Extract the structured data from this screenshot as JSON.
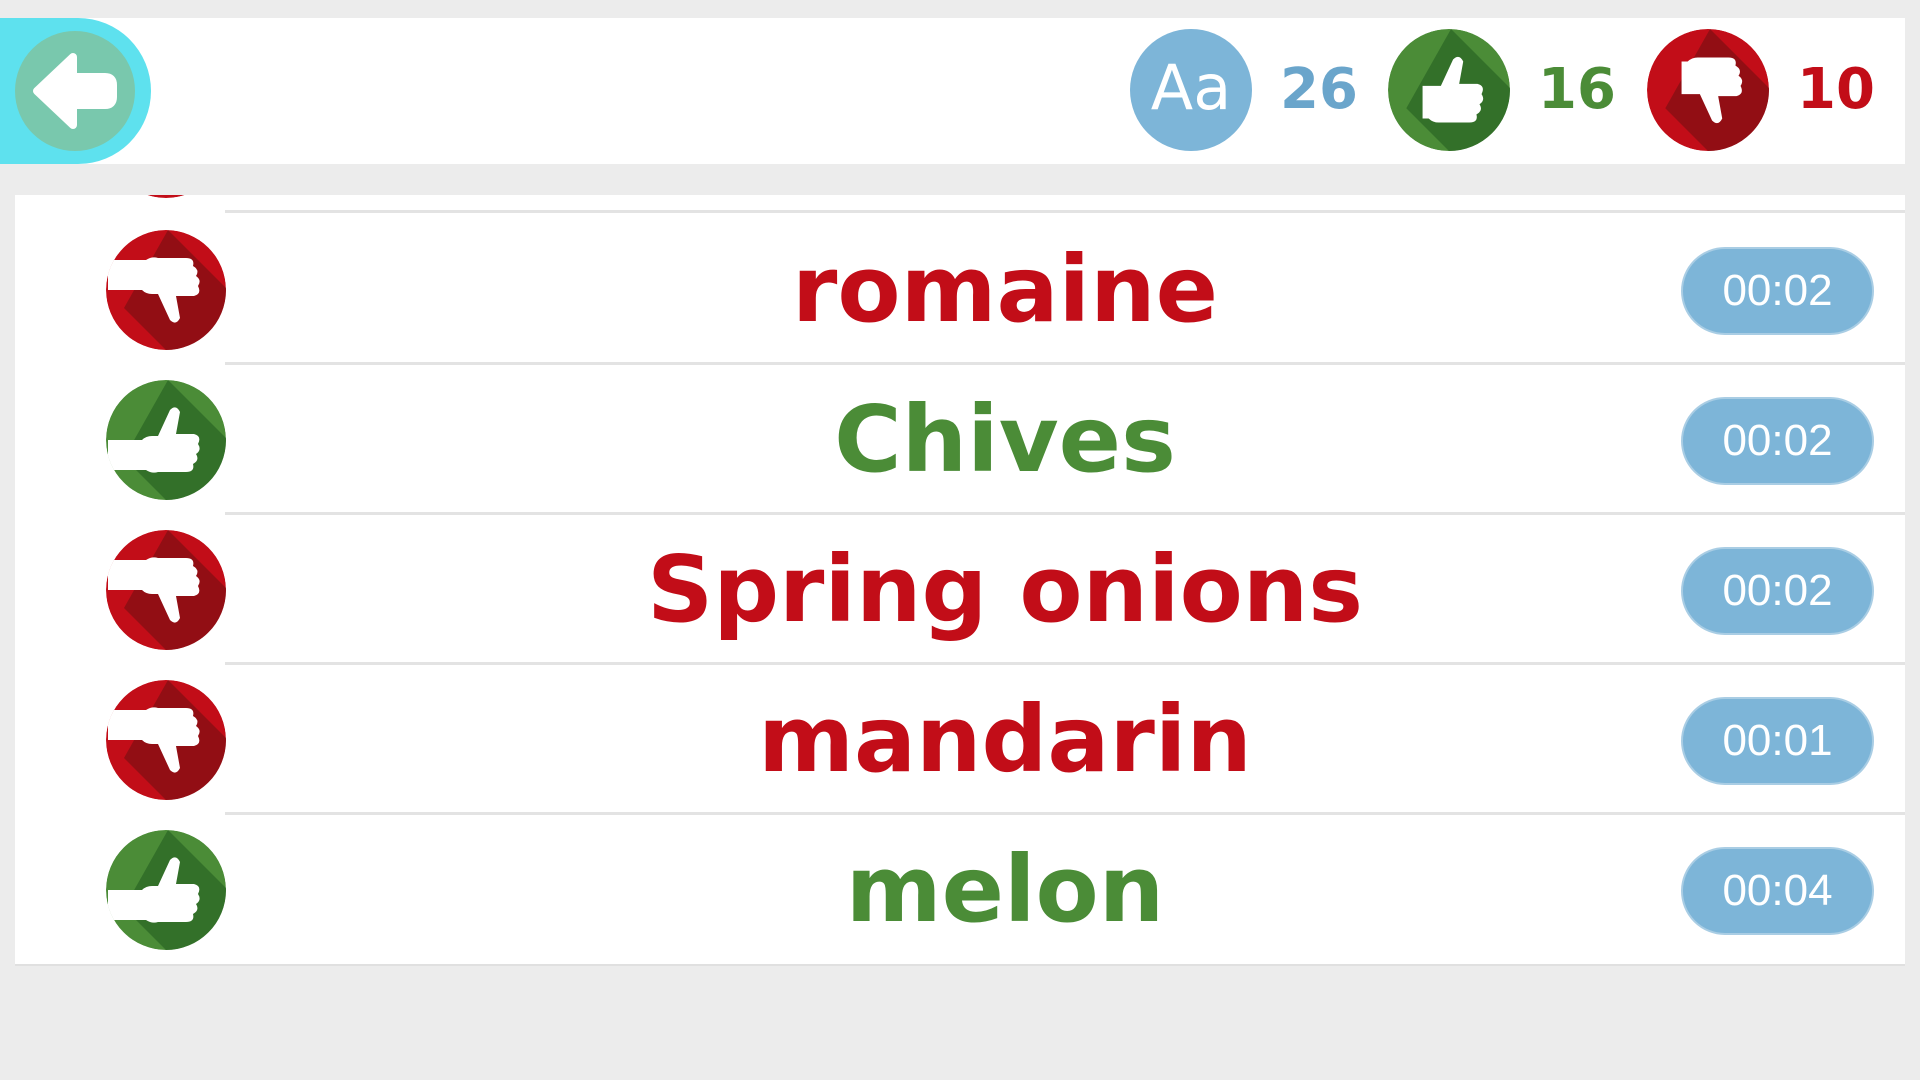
{
  "colors": {
    "background": "#ececec",
    "back_tab": "#5ee1ee",
    "back_circle": "#79c8ad",
    "blue": "#7db5d8",
    "blue_text": "#6aa5cb",
    "green": "#4b8c37",
    "green_dark": "#2f6b27",
    "red": "#c20d18",
    "red_dark": "#8a0f14"
  },
  "header": {
    "back_icon": "arrow-left-icon",
    "words_badge": "Aa",
    "words_count": "26",
    "right_count": "16",
    "wrong_count": "10"
  },
  "rows": [
    {
      "word": "romaine",
      "result": "wrong",
      "icon": "thumbs-down-icon",
      "time": "00:02"
    },
    {
      "word": "Chives",
      "result": "right",
      "icon": "thumbs-up-icon",
      "time": "00:02"
    },
    {
      "word": "Spring onions",
      "result": "wrong",
      "icon": "thumbs-down-icon",
      "time": "00:02"
    },
    {
      "word": "mandarin",
      "result": "wrong",
      "icon": "thumbs-down-icon",
      "time": "00:01"
    },
    {
      "word": "melon",
      "result": "right",
      "icon": "thumbs-up-icon",
      "time": "00:04"
    }
  ]
}
